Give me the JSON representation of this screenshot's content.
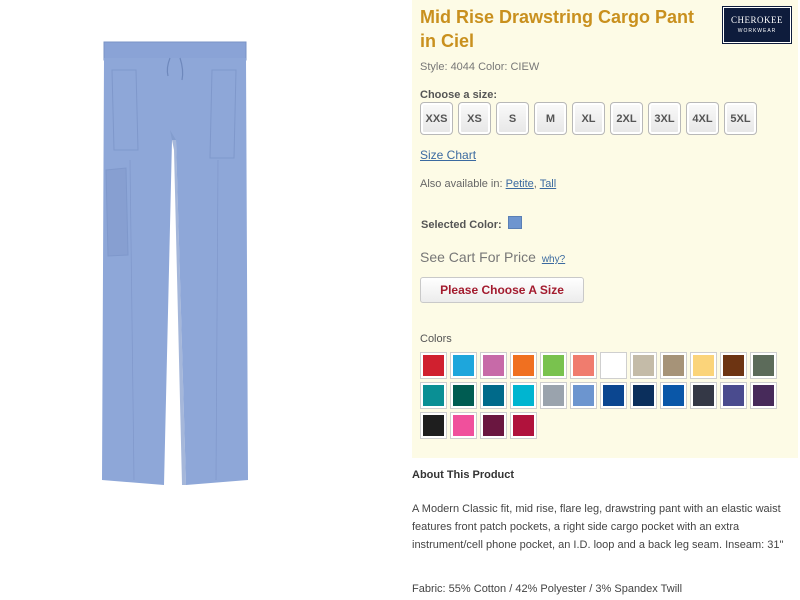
{
  "product": {
    "title": "Mid Rise Drawstring Cargo Pant in Ciel",
    "style_line": "Style: 4044 Color: CIEW",
    "image_color": "#8ea7d8"
  },
  "brand": {
    "name": "CHEROKEE",
    "sub": "WORKWEAR"
  },
  "size_selector": {
    "label": "Choose a size:",
    "sizes": [
      "XXS",
      "XS",
      "S",
      "M",
      "XL",
      "2XL",
      "3XL",
      "4XL",
      "5XL"
    ]
  },
  "links": {
    "size_chart": "Size Chart",
    "also_available_prefix": "Also available in:",
    "petite": "Petite",
    "comma": ",",
    "tall": "Tall"
  },
  "selected_color": {
    "label": "Selected Color:",
    "value": "#6e95cf"
  },
  "price": {
    "text": "See Cart For Price",
    "why": "why?"
  },
  "add_button": {
    "label": "Please Choose A Size"
  },
  "colors": {
    "label": "Colors",
    "swatches": [
      "#d0202f",
      "#1ea6dc",
      "#c76aa8",
      "#f07020",
      "#79c24e",
      "#f07c6e",
      "#ffffff",
      "#c4bba8",
      "#a69378",
      "#fbd47a",
      "#6d3412",
      "#5c6b5a",
      "#0a8f94",
      "#005c52",
      "#006a8a",
      "#00b5d0",
      "#9aa3ad",
      "#6c95cf",
      "#0b4690",
      "#0b2f5c",
      "#0a57a8",
      "#343846",
      "#4a4b8e",
      "#472a5a",
      "#1e1e1e",
      "#f0509c",
      "#6a1640",
      "#b0123c"
    ]
  },
  "about": {
    "title": "About This Product",
    "description": "A Modern Classic fit, mid rise, flare leg, drawstring pant with an elastic waist features front patch pockets, a right side cargo pocket with an extra instrument/cell phone pocket, an I.D. loop and a back leg seam. Inseam: 31\"",
    "fabric": "Fabric: 55% Cotton / 42% Polyester / 3% Spandex Twill"
  }
}
